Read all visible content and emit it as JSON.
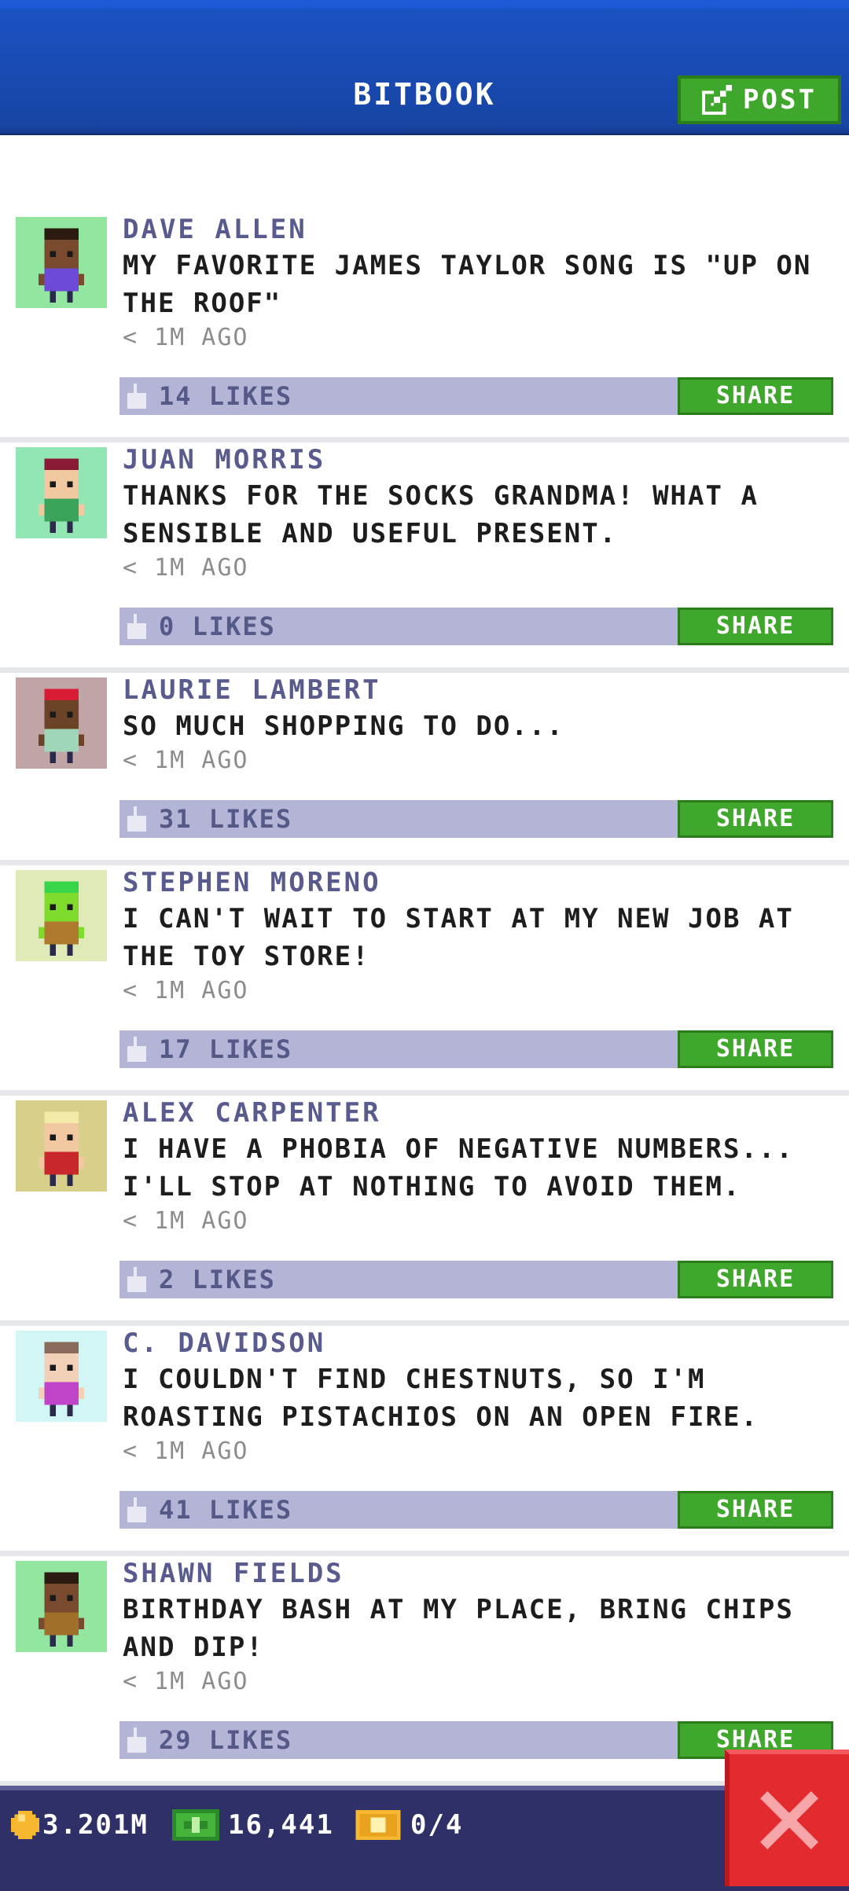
{
  "header": {
    "title": "BITBOOK",
    "post_label": "POST"
  },
  "posts": [
    {
      "name": "DAVE ALLEN",
      "message": "MY FAVORITE JAMES TAYLOR SONG IS \"UP ON THE ROOF\"",
      "time": "< 1M AGO",
      "likes": "14 LIKES",
      "share": "SHARE",
      "bg": "#92e6a0",
      "skin": "#7a4a2e",
      "hair": "#2a1a10",
      "shirt": "#6c4cd6",
      "hat": ""
    },
    {
      "name": "JUAN MORRIS",
      "message": "THANKS FOR THE SOCKS GRANDMA! WHAT A SENSIBLE AND USEFUL PRESENT.",
      "time": "< 1M AGO",
      "likes": "0 LIKES",
      "share": "SHARE",
      "bg": "#92e6b4",
      "skin": "#f2c8a0",
      "hair": "#8a1b34",
      "shirt": "#3aa55a",
      "hat": "#8a1b34"
    },
    {
      "name": "LAURIE LAMBERT",
      "message": "SO MUCH SHOPPING TO DO...",
      "time": "< 1M AGO",
      "likes": "31 LIKES",
      "share": "SHARE",
      "bg": "#c0a4a6",
      "skin": "#6b4428",
      "hair": "#d81c36",
      "shirt": "#9fd6b8",
      "hat": "#d81c36"
    },
    {
      "name": "STEPHEN MORENO",
      "message": "I CAN'T WAIT TO START AT MY NEW JOB AT THE TOY STORE!",
      "time": "< 1M AGO",
      "likes": "17 LIKES",
      "share": "SHARE",
      "bg": "#e0eab8",
      "skin": "#7fdc2c",
      "hair": "#38d44a",
      "shirt": "#b07a2e",
      "hat": ""
    },
    {
      "name": "ALEX CARPENTER",
      "message": "I HAVE A PHOBIA OF NEGATIVE NUMBERS... I'LL STOP AT NOTHING TO AVOID THEM.",
      "time": "< 1M AGO",
      "likes": "2 LIKES",
      "share": "SHARE",
      "bg": "#d8d08a",
      "skin": "#f2c8a0",
      "hair": "#f4eaa8",
      "shirt": "#c8282c",
      "hat": ""
    },
    {
      "name": "C. DAVIDSON",
      "message": "I COULDN'T FIND CHESTNUTS, SO I'M ROASTING PISTACHIOS ON AN OPEN FIRE.",
      "time": "< 1M AGO",
      "likes": "41 LIKES",
      "share": "SHARE",
      "bg": "#d2f6f4",
      "skin": "#f2d0b8",
      "hair": "#8a6a5a",
      "shirt": "#c044c8",
      "hat": ""
    },
    {
      "name": "SHAWN FIELDS",
      "message": "BIRTHDAY BASH AT MY PLACE, BRING CHIPS AND DIP!",
      "time": "< 1M AGO",
      "likes": "29 LIKES",
      "share": "SHARE",
      "bg": "#92e6a0",
      "skin": "#7a4a2e",
      "hair": "#2a1a10",
      "shirt": "#a0702a",
      "hat": ""
    }
  ],
  "footer": {
    "coins": "3.201M",
    "bux": "16,441",
    "tickets": "0/4"
  },
  "colors": {
    "accent_green": "#3fa72b",
    "header_blue": "#1844a4",
    "like_bar": "#b4b5d6",
    "close_red": "#e22a2f"
  }
}
